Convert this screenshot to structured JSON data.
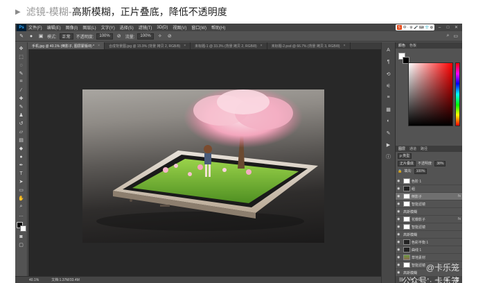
{
  "heading": {
    "prefix": "滤镜-模糊-",
    "main": "高斯模糊，正片叠底，降低不透明度"
  },
  "photoshop": {
    "logo": "Ps",
    "menus": [
      "文件(F)",
      "编辑(E)",
      "图像(I)",
      "图层(L)",
      "文字(Y)",
      "选择(S)",
      "滤镜(T)",
      "3D(D)",
      "视图(V)",
      "窗口(W)",
      "帮助(H)"
    ],
    "ime": {
      "badge": "S",
      "text": "中 · ⚙ 🎤 ⌨ 👕 ✿"
    },
    "options": {
      "mode_label": "模式:",
      "mode_value": "正常",
      "opacity_label": "不透明度:",
      "opacity_value": "100%",
      "flow_label": "流量:",
      "flow_value": "100%"
    },
    "tabs": [
      {
        "label": "手机.jpg @ 40.1% (倒影子, 图层蒙版/8) *",
        "active": true
      },
      {
        "label": "合成背景图.jpg @ 15.9% (背景 拷贝 2, RGB/8)",
        "active": false
      },
      {
        "label": "未标题-1 @ 33.3% (背景 拷贝 2, RGB/8)",
        "active": false
      },
      {
        "label": "未标题-2.psd @ 66.7% (背景 拷贝 3, RGB/8)",
        "active": false
      }
    ],
    "status": {
      "zoom": "40.1%",
      "doc": "文档:1.37M/33.4M"
    },
    "panels": {
      "color_tabs": [
        "颜色",
        "色板"
      ],
      "layers_tabs": [
        "图层",
        "通道",
        "路径"
      ],
      "kind_label": "ρ 类型",
      "blend_mode": "正片叠底",
      "opacity_label": "不透明度:",
      "opacity_value": "38%",
      "fill_label": "填充:",
      "fill_value": "100%",
      "layers": [
        {
          "name": "色阶 1",
          "thumb": "white",
          "selected": false,
          "fx": ""
        },
        {
          "name": "组",
          "thumb": "dark",
          "selected": false,
          "fx": ""
        },
        {
          "name": "倒影子",
          "thumb": "white",
          "selected": true,
          "fx": "fx"
        },
        {
          "name": "智能滤镜",
          "thumb": "white",
          "selected": false,
          "fx": ""
        },
        {
          "name": "高斯模糊",
          "thumb": "none",
          "selected": false,
          "fx": ""
        },
        {
          "name": "花瓣影子",
          "thumb": "white",
          "selected": false,
          "fx": "fx"
        },
        {
          "name": "智能滤镜",
          "thumb": "white",
          "selected": false,
          "fx": ""
        },
        {
          "name": "高斯模糊",
          "thumb": "none",
          "selected": false,
          "fx": ""
        },
        {
          "name": "色彩平衡 1",
          "thumb": "dark",
          "selected": false,
          "fx": ""
        },
        {
          "name": "曲线 1",
          "thumb": "dark",
          "selected": false,
          "fx": ""
        },
        {
          "name": "草地素材",
          "thumb": "photo",
          "selected": false,
          "fx": ""
        },
        {
          "name": "智能滤镜",
          "thumb": "white",
          "selected": false,
          "fx": ""
        },
        {
          "name": "高斯模糊",
          "thumb": "none",
          "selected": false,
          "fx": ""
        },
        {
          "name": "背景",
          "thumb": "photo",
          "selected": false,
          "fx": ""
        }
      ]
    }
  },
  "watermark": {
    "line1": "@卡乐笼",
    "line2": "公众号 · 卡乐笼"
  }
}
